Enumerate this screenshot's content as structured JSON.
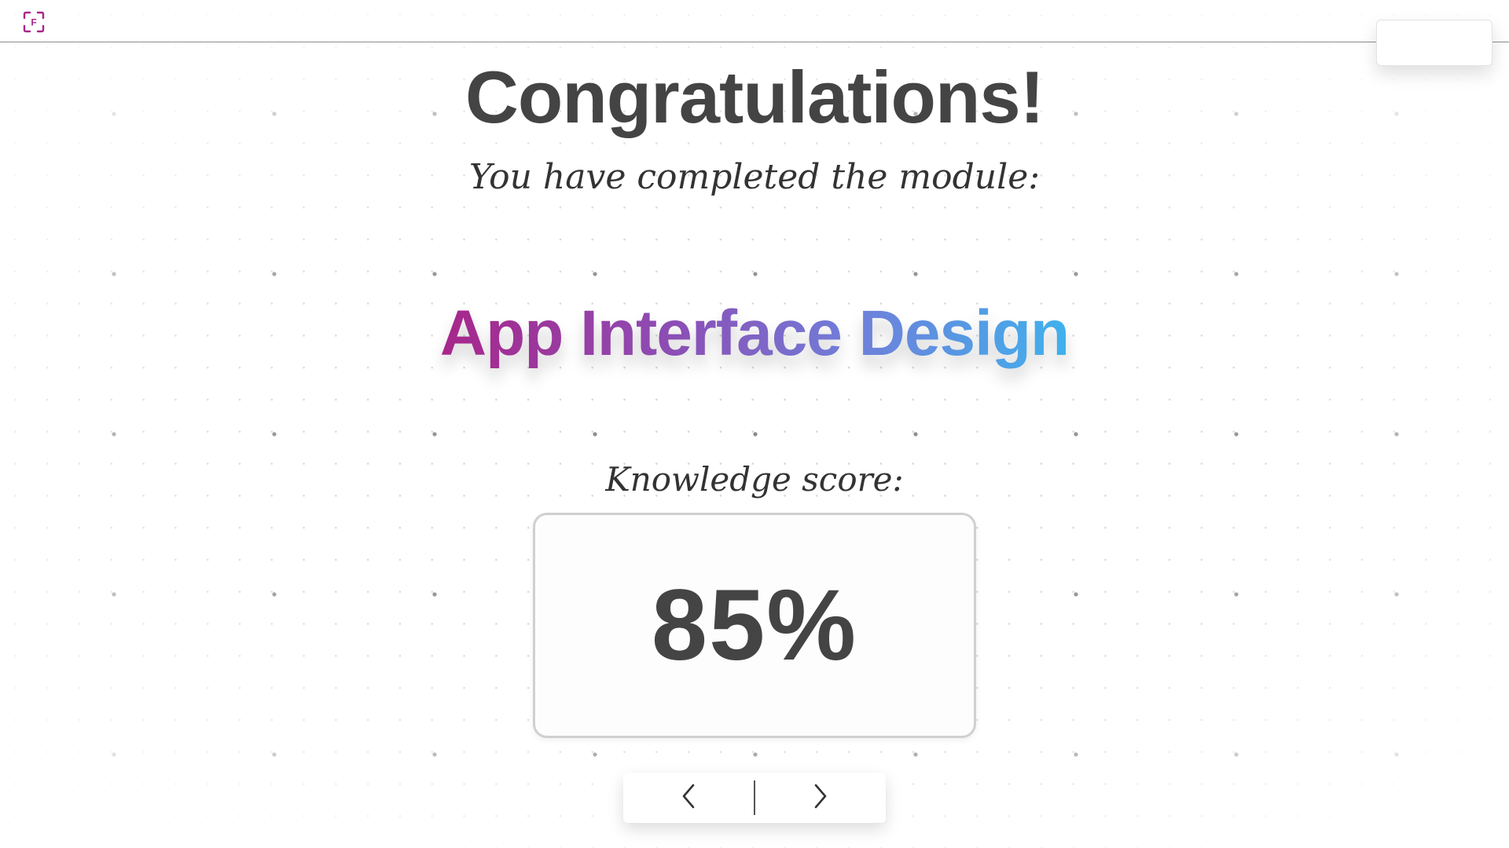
{
  "title": "Congratulations!",
  "subtitle": "You have completed the module:",
  "module": {
    "name": "App Interface Design"
  },
  "score": {
    "label": "Knowledge score:",
    "value": "85%"
  },
  "colors": {
    "logo": "#a8268a",
    "gradient_start": "#a8268a",
    "gradient_mid": "#6f7fda",
    "gradient_end": "#3fb1ec",
    "text": "#444444"
  },
  "icons": {
    "logo": "focus-frame-f-icon",
    "prev": "chevron-left-icon",
    "next": "chevron-right-icon"
  }
}
